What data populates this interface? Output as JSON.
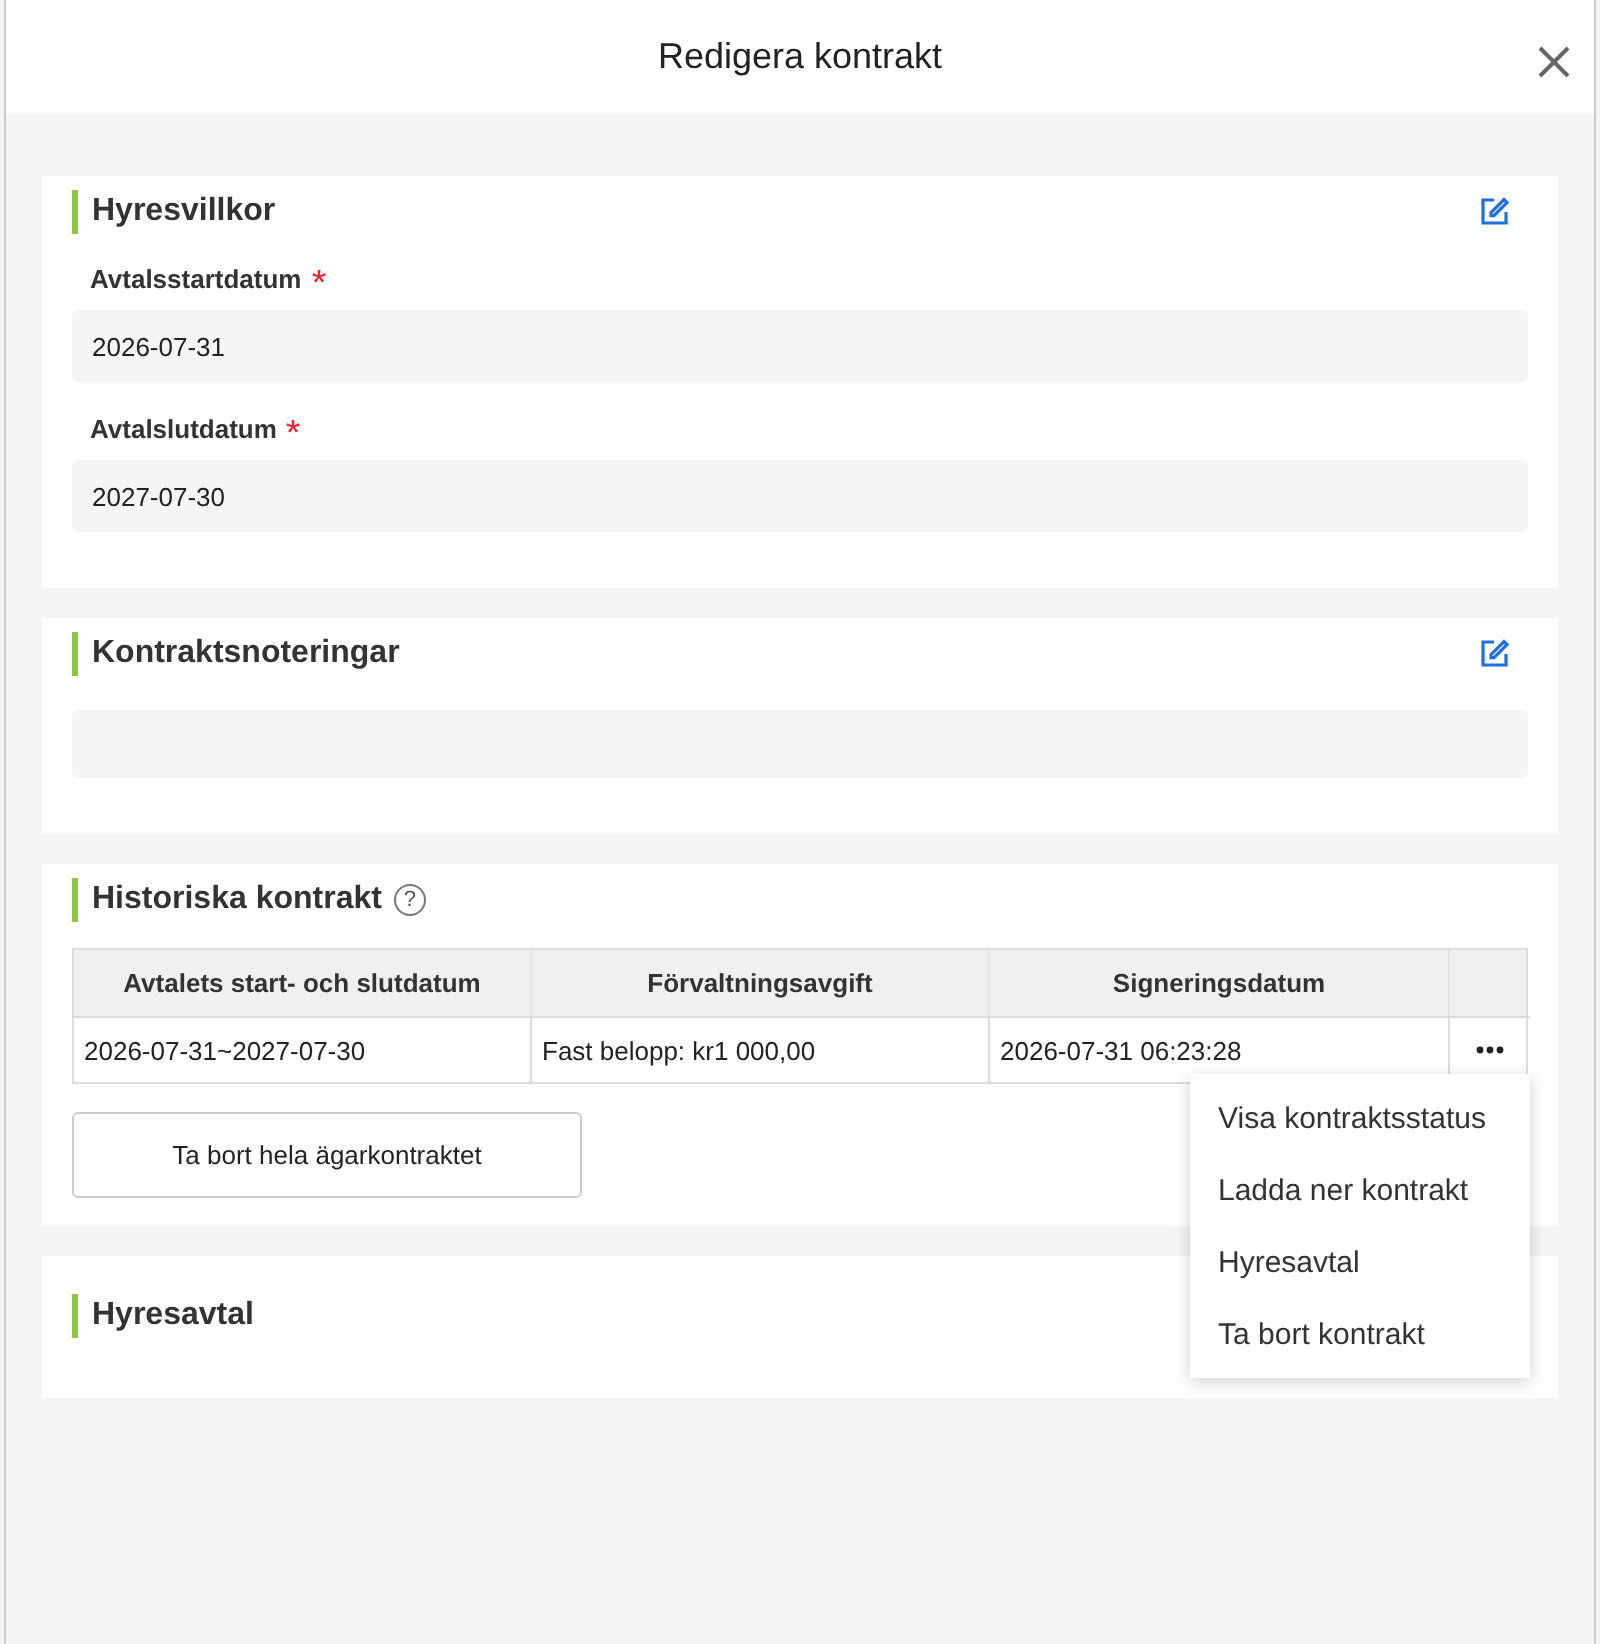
{
  "window": {
    "title": "Redigera kontrakt"
  },
  "terms": {
    "title": "Hyresvillkor",
    "editable": true,
    "fields": [
      {
        "label": "Avtalsstartdatum",
        "required": true,
        "value": "2026-07-31"
      },
      {
        "label": "Avtalslutdatum",
        "required": true,
        "value": "2027-07-30"
      }
    ]
  },
  "notes": {
    "title": "Kontraktsnoteringar",
    "editable": true
  },
  "history": {
    "title": "Historiska kontrakt",
    "help": "?",
    "columns": [
      "Avtalets start- och slutdatum",
      "Förvaltningsavgift",
      "Signeringsdatum"
    ],
    "rows": [
      {
        "cells": [
          "2026-07-31~2027-07-30",
          "Fast belopp: kr1 000,00",
          "2026-07-31 06:23:28"
        ]
      }
    ],
    "delete_button": "Ta bort hela ägarkontraktet",
    "menu": [
      "Visa kontraktsstatus",
      "Ladda ner kontrakt",
      "Hyresavtal",
      "Ta bort kontrakt"
    ]
  },
  "lease": {
    "title": "Hyresavtal"
  }
}
